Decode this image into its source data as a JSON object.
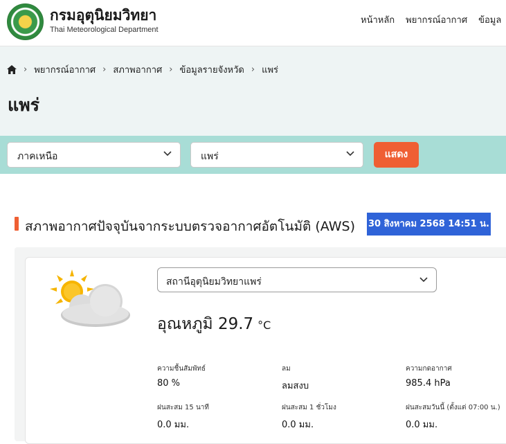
{
  "header": {
    "org_name_th": "กรมอุตุนิยมวิทยา",
    "org_name_en": "Thai Meteorological Department",
    "nav": [
      "หน้าหลัก",
      "พยากรณ์อากาศ",
      "ข้อมูล"
    ]
  },
  "breadcrumb": [
    "พยากรณ์อากาศ",
    "สภาพอากาศ",
    "ข้อมูลรายจังหวัด",
    "แพร่"
  ],
  "page_title": "แพร่",
  "filters": {
    "region": "ภาคเหนือ",
    "province": "แพร่",
    "show_label": "แสดง"
  },
  "section": {
    "title": "สภาพอากาศปัจจุบันจากระบบตรวจอากาศอัตโนมัติ (AWS)",
    "timestamp": "30 สิงหาคม 2568 14:51 น."
  },
  "weather": {
    "icon": "partly-cloudy-icon",
    "station": "สถานีอุตุนิยมวิทยาแพร่",
    "temp_label": "อุณหภูมิ 29.7",
    "temp_unit": "°C",
    "metrics": [
      {
        "label": "ความชื้นสัมพัทธ์",
        "value": "80 %"
      },
      {
        "label": "ลม",
        "value": "ลมสงบ"
      },
      {
        "label": "ความกดอากาศ",
        "value": "985.4 hPa"
      },
      {
        "label": "ฝนสะสม 15 นาที",
        "value": "0.0 มม."
      },
      {
        "label": "ฝนสะสม 1 ชั่วโมง",
        "value": "0.0 มม."
      },
      {
        "label": "ฝนสะสมวันนี้ (ตั้งแต่ 07:00 น.)",
        "value": "0.0 มม."
      }
    ]
  },
  "colors": {
    "accent_orange": "#ef5f33",
    "filter_bar": "#a8ddd6",
    "hero_bg": "#eef4f4",
    "highlight_blue": "#2f63d8"
  }
}
